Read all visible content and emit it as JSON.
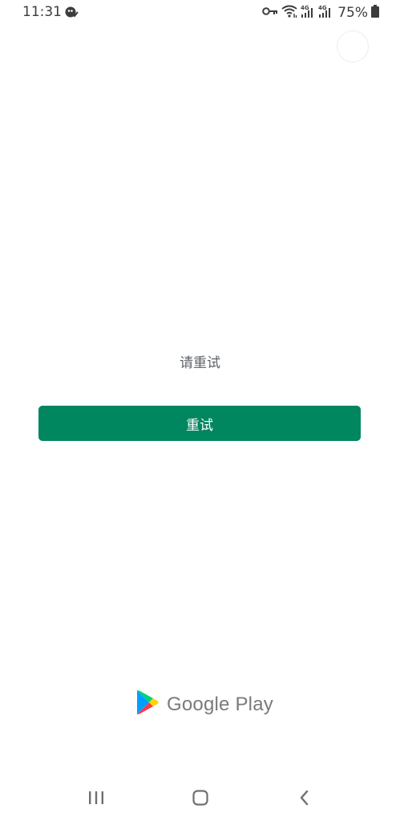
{
  "status_bar": {
    "time": "11:31",
    "battery": "75%",
    "left_icon": "sync-check-icon",
    "right_icons": [
      "vpn-key-icon",
      "wifi-icon",
      "signal-4g-icon",
      "signal-4g-icon",
      "battery-icon"
    ]
  },
  "main": {
    "message": "请重试",
    "retry_label": "重试"
  },
  "brand": {
    "name": "Google Play",
    "button_color": "#01875f"
  },
  "nav_bar": {
    "items": [
      "recents-icon",
      "home-icon",
      "back-icon"
    ]
  }
}
